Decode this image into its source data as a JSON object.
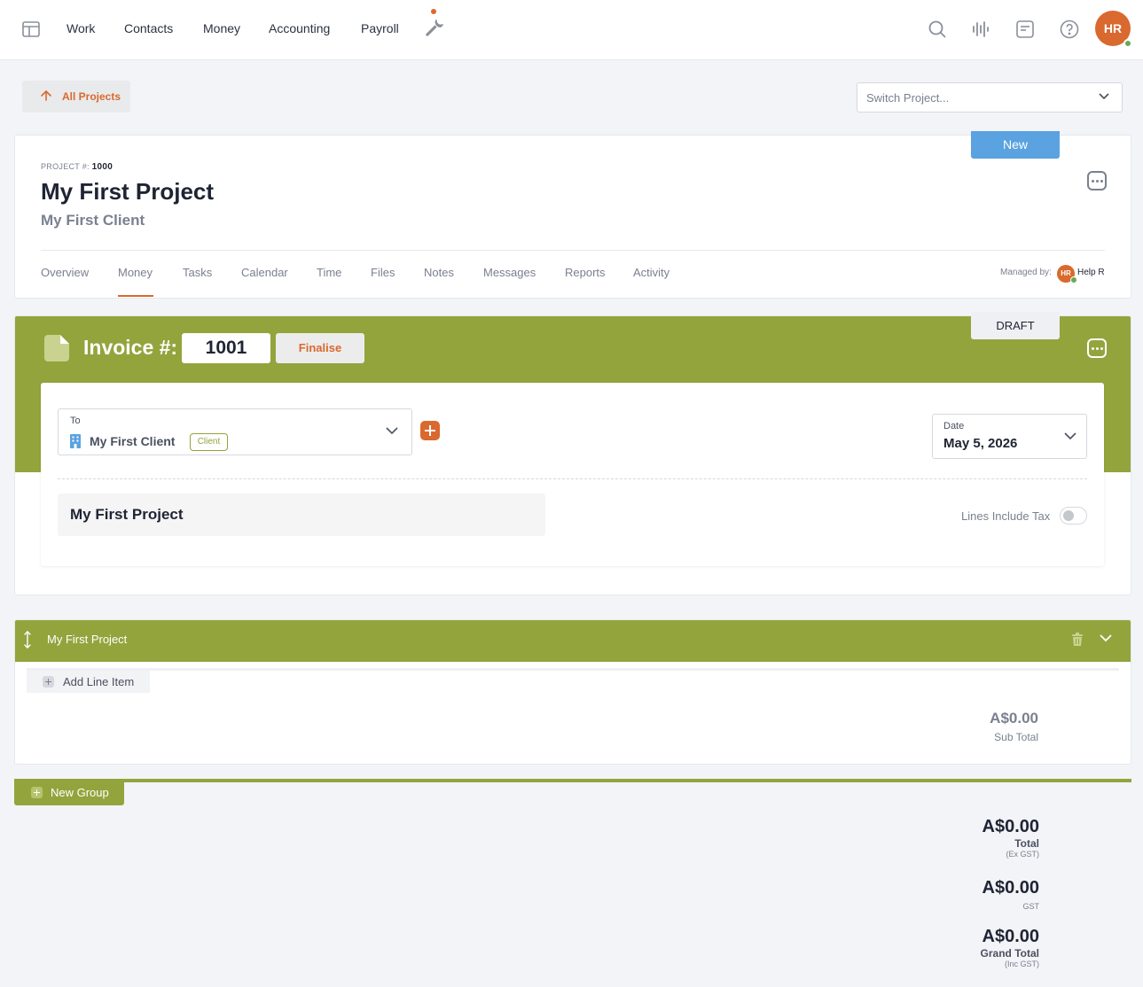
{
  "nav": {
    "items": [
      "Work",
      "Contacts",
      "Money",
      "Accounting",
      "Payroll"
    ],
    "avatar_initials": "HR",
    "icons": [
      "apps-icon",
      "tools-icon",
      "search-icon",
      "activity-icon",
      "messages-icon",
      "help-icon"
    ]
  },
  "project_bar": {
    "all_projects_label": "All Projects",
    "switch_placeholder": "Switch Project..."
  },
  "project": {
    "status_badge": "New",
    "number_label": "PROJECT #:",
    "number": "1000",
    "title": "My First Project",
    "client": "My First Client",
    "tabs": [
      "Overview",
      "Money",
      "Tasks",
      "Calendar",
      "Time",
      "Files",
      "Notes",
      "Messages",
      "Reports",
      "Activity"
    ],
    "active_tab": "Money",
    "managed_by_label": "Managed by:",
    "manager_initials": "HR",
    "manager_name": "Help R"
  },
  "invoice": {
    "status_badge": "DRAFT",
    "label": "Invoice #:",
    "number": "1001",
    "finalise_label": "Finalise",
    "to_label": "To",
    "to_client": "My First Client",
    "client_tag": "Client",
    "date_label": "Date",
    "date_value": "May 5, 2026",
    "project_name": "My First Project",
    "lines_include_tax_label": "Lines Include Tax",
    "lines_include_tax": false
  },
  "group": {
    "title": "My First Project",
    "add_line_label": "Add Line Item",
    "subtotal_value": "A$0.00",
    "subtotal_label": "Sub Total"
  },
  "new_group_label": "New Group",
  "totals": {
    "total_value": "A$0.00",
    "total_label": "Total",
    "total_sub": "(Ex GST)",
    "gst_value": "A$0.00",
    "gst_label": "GST",
    "grand_value": "A$0.00",
    "grand_label": "Grand Total",
    "grand_sub": "(Inc GST)"
  },
  "colors": {
    "accent": "#d9692e",
    "invoice_green": "#93a43d",
    "new_badge_blue": "#5aa2e0"
  }
}
